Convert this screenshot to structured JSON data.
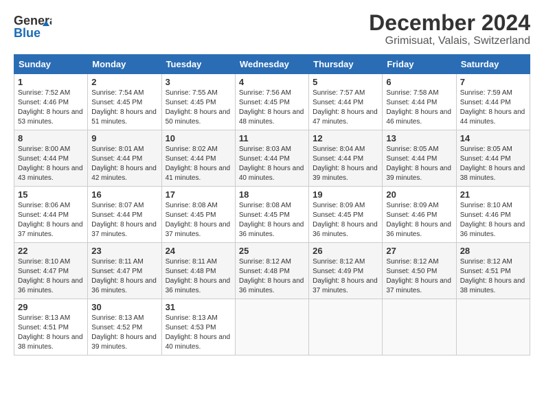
{
  "header": {
    "logo_line1": "General",
    "logo_line2": "Blue",
    "title": "December 2024",
    "subtitle": "Grimisuat, Valais, Switzerland"
  },
  "days_of_week": [
    "Sunday",
    "Monday",
    "Tuesday",
    "Wednesday",
    "Thursday",
    "Friday",
    "Saturday"
  ],
  "weeks": [
    [
      {
        "day": "1",
        "sunrise": "Sunrise: 7:52 AM",
        "sunset": "Sunset: 4:46 PM",
        "daylight": "Daylight: 8 hours and 53 minutes."
      },
      {
        "day": "2",
        "sunrise": "Sunrise: 7:54 AM",
        "sunset": "Sunset: 4:45 PM",
        "daylight": "Daylight: 8 hours and 51 minutes."
      },
      {
        "day": "3",
        "sunrise": "Sunrise: 7:55 AM",
        "sunset": "Sunset: 4:45 PM",
        "daylight": "Daylight: 8 hours and 50 minutes."
      },
      {
        "day": "4",
        "sunrise": "Sunrise: 7:56 AM",
        "sunset": "Sunset: 4:45 PM",
        "daylight": "Daylight: 8 hours and 48 minutes."
      },
      {
        "day": "5",
        "sunrise": "Sunrise: 7:57 AM",
        "sunset": "Sunset: 4:44 PM",
        "daylight": "Daylight: 8 hours and 47 minutes."
      },
      {
        "day": "6",
        "sunrise": "Sunrise: 7:58 AM",
        "sunset": "Sunset: 4:44 PM",
        "daylight": "Daylight: 8 hours and 46 minutes."
      },
      {
        "day": "7",
        "sunrise": "Sunrise: 7:59 AM",
        "sunset": "Sunset: 4:44 PM",
        "daylight": "Daylight: 8 hours and 44 minutes."
      }
    ],
    [
      {
        "day": "8",
        "sunrise": "Sunrise: 8:00 AM",
        "sunset": "Sunset: 4:44 PM",
        "daylight": "Daylight: 8 hours and 43 minutes."
      },
      {
        "day": "9",
        "sunrise": "Sunrise: 8:01 AM",
        "sunset": "Sunset: 4:44 PM",
        "daylight": "Daylight: 8 hours and 42 minutes."
      },
      {
        "day": "10",
        "sunrise": "Sunrise: 8:02 AM",
        "sunset": "Sunset: 4:44 PM",
        "daylight": "Daylight: 8 hours and 41 minutes."
      },
      {
        "day": "11",
        "sunrise": "Sunrise: 8:03 AM",
        "sunset": "Sunset: 4:44 PM",
        "daylight": "Daylight: 8 hours and 40 minutes."
      },
      {
        "day": "12",
        "sunrise": "Sunrise: 8:04 AM",
        "sunset": "Sunset: 4:44 PM",
        "daylight": "Daylight: 8 hours and 39 minutes."
      },
      {
        "day": "13",
        "sunrise": "Sunrise: 8:05 AM",
        "sunset": "Sunset: 4:44 PM",
        "daylight": "Daylight: 8 hours and 39 minutes."
      },
      {
        "day": "14",
        "sunrise": "Sunrise: 8:05 AM",
        "sunset": "Sunset: 4:44 PM",
        "daylight": "Daylight: 8 hours and 38 minutes."
      }
    ],
    [
      {
        "day": "15",
        "sunrise": "Sunrise: 8:06 AM",
        "sunset": "Sunset: 4:44 PM",
        "daylight": "Daylight: 8 hours and 37 minutes."
      },
      {
        "day": "16",
        "sunrise": "Sunrise: 8:07 AM",
        "sunset": "Sunset: 4:44 PM",
        "daylight": "Daylight: 8 hours and 37 minutes."
      },
      {
        "day": "17",
        "sunrise": "Sunrise: 8:08 AM",
        "sunset": "Sunset: 4:45 PM",
        "daylight": "Daylight: 8 hours and 37 minutes."
      },
      {
        "day": "18",
        "sunrise": "Sunrise: 8:08 AM",
        "sunset": "Sunset: 4:45 PM",
        "daylight": "Daylight: 8 hours and 36 minutes."
      },
      {
        "day": "19",
        "sunrise": "Sunrise: 8:09 AM",
        "sunset": "Sunset: 4:45 PM",
        "daylight": "Daylight: 8 hours and 36 minutes."
      },
      {
        "day": "20",
        "sunrise": "Sunrise: 8:09 AM",
        "sunset": "Sunset: 4:46 PM",
        "daylight": "Daylight: 8 hours and 36 minutes."
      },
      {
        "day": "21",
        "sunrise": "Sunrise: 8:10 AM",
        "sunset": "Sunset: 4:46 PM",
        "daylight": "Daylight: 8 hours and 36 minutes."
      }
    ],
    [
      {
        "day": "22",
        "sunrise": "Sunrise: 8:10 AM",
        "sunset": "Sunset: 4:47 PM",
        "daylight": "Daylight: 8 hours and 36 minutes."
      },
      {
        "day": "23",
        "sunrise": "Sunrise: 8:11 AM",
        "sunset": "Sunset: 4:47 PM",
        "daylight": "Daylight: 8 hours and 36 minutes."
      },
      {
        "day": "24",
        "sunrise": "Sunrise: 8:11 AM",
        "sunset": "Sunset: 4:48 PM",
        "daylight": "Daylight: 8 hours and 36 minutes."
      },
      {
        "day": "25",
        "sunrise": "Sunrise: 8:12 AM",
        "sunset": "Sunset: 4:48 PM",
        "daylight": "Daylight: 8 hours and 36 minutes."
      },
      {
        "day": "26",
        "sunrise": "Sunrise: 8:12 AM",
        "sunset": "Sunset: 4:49 PM",
        "daylight": "Daylight: 8 hours and 37 minutes."
      },
      {
        "day": "27",
        "sunrise": "Sunrise: 8:12 AM",
        "sunset": "Sunset: 4:50 PM",
        "daylight": "Daylight: 8 hours and 37 minutes."
      },
      {
        "day": "28",
        "sunrise": "Sunrise: 8:12 AM",
        "sunset": "Sunset: 4:51 PM",
        "daylight": "Daylight: 8 hours and 38 minutes."
      }
    ],
    [
      {
        "day": "29",
        "sunrise": "Sunrise: 8:13 AM",
        "sunset": "Sunset: 4:51 PM",
        "daylight": "Daylight: 8 hours and 38 minutes."
      },
      {
        "day": "30",
        "sunrise": "Sunrise: 8:13 AM",
        "sunset": "Sunset: 4:52 PM",
        "daylight": "Daylight: 8 hours and 39 minutes."
      },
      {
        "day": "31",
        "sunrise": "Sunrise: 8:13 AM",
        "sunset": "Sunset: 4:53 PM",
        "daylight": "Daylight: 8 hours and 40 minutes."
      },
      null,
      null,
      null,
      null
    ]
  ]
}
